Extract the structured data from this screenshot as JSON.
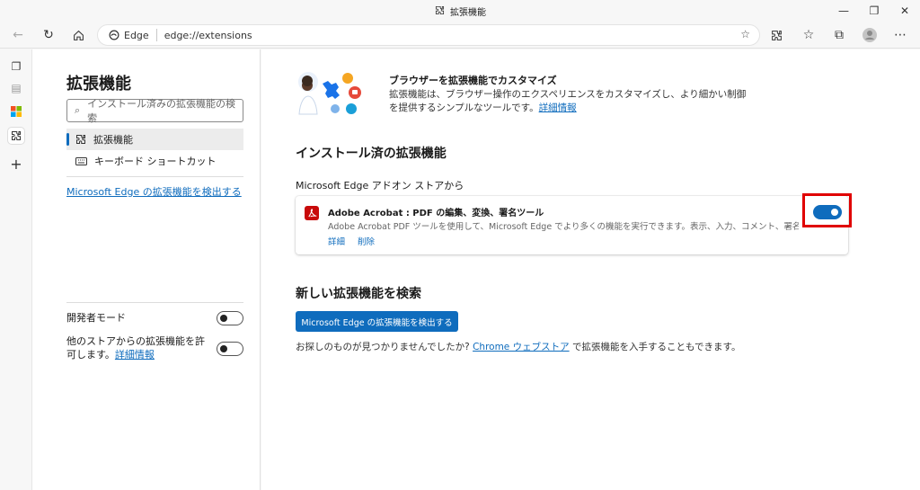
{
  "window": {
    "title": "拡張機能",
    "controls": {
      "minimize": "—",
      "restore": "❐",
      "close": "✕"
    }
  },
  "toolbar": {
    "brand": "Edge",
    "url": "edge://extensions"
  },
  "sidebar": {
    "title": "拡張機能",
    "search_placeholder": "インストール済みの拡張機能の検索",
    "items": [
      {
        "label": "拡張機能",
        "active": true,
        "icon": "puzzle-icon"
      },
      {
        "label": "キーボード ショートカット",
        "active": false,
        "icon": "keyboard-icon"
      }
    ],
    "discover_link": "Microsoft Edge の拡張機能を検出する",
    "dev_mode_label": "開発者モード",
    "dev_mode_on": false,
    "allow_other_label": "他のストアからの拡張機能を許可します。",
    "allow_other_link": "詳細情報",
    "allow_other_on": false
  },
  "main": {
    "hero_title": "ブラウザーを拡張機能でカスタマイズ",
    "hero_desc": "拡張機能は、ブラウザー操作のエクスペリエンスをカスタマイズし、より細かい制御を提供するシンプルなツールです。",
    "hero_link": "詳細情報",
    "installed_title": "インストール済の拡張機能",
    "source_label": "Microsoft Edge アドオン ストアから",
    "extension": {
      "name": "Adobe Acrobat : PDF の編集、変換、署名ツール",
      "desc": "Adobe Acrobat PDF ツールを使用して、Microsoft Edge でより多くの機能を実行できます。表示、入力、コメント、署名、変換、圧縮ツールをお試しください。",
      "details_link": "詳細",
      "remove_link": "削除",
      "enabled": true
    },
    "find_title": "新しい拡張機能を検索",
    "find_button": "Microsoft Edge の拡張機能を検出する",
    "footer_prefix": "お探しのものが見つかりませんでしたか?",
    "footer_link": "Chrome ウェブストア",
    "footer_suffix": "で拡張機能を入手することもできます。"
  },
  "colors": {
    "accent": "#0f6cbd",
    "highlight": "#e00000",
    "acrobat": "#c80a0a"
  }
}
